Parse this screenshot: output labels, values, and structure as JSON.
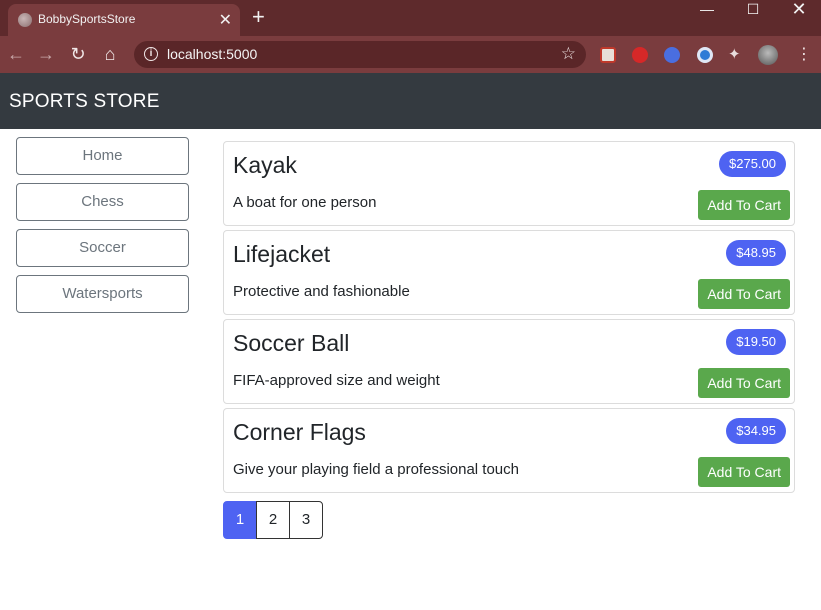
{
  "browser": {
    "tab_title": "BobbySportsStore",
    "tab_close": "✕",
    "new_tab": "+",
    "url": "localhost:5000"
  },
  "navbar": {
    "brand": "SPORTS STORE"
  },
  "sidebar": {
    "categories": [
      "Home",
      "Chess",
      "Soccer",
      "Watersports"
    ]
  },
  "products": [
    {
      "name": "Kayak",
      "price": "$275.00",
      "description": "A boat for one person",
      "add_label": "Add To Cart"
    },
    {
      "name": "Lifejacket",
      "price": "$48.95",
      "description": "Protective and fashionable",
      "add_label": "Add To Cart"
    },
    {
      "name": "Soccer Ball",
      "price": "$19.50",
      "description": "FIFA-approved size and weight",
      "add_label": "Add To Cart"
    },
    {
      "name": "Corner Flags",
      "price": "$34.95",
      "description": "Give your playing field a professional touch",
      "add_label": "Add To Cart"
    }
  ],
  "pagination": {
    "pages": [
      "1",
      "2",
      "3"
    ],
    "current": "1"
  },
  "colors": {
    "navbar": "#343a40",
    "price_badge": "#4e63f2",
    "add_button": "#5aa84c",
    "browser_frame": "#7a3c3e"
  }
}
